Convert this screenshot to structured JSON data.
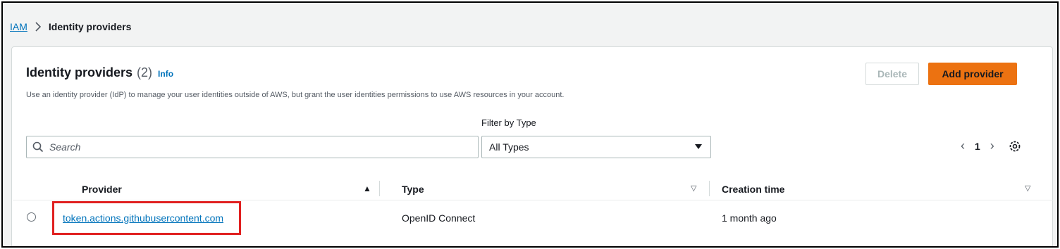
{
  "breadcrumb": {
    "root": "IAM",
    "current": "Identity providers"
  },
  "panel": {
    "title": "Identity providers",
    "count": "(2)",
    "info_label": "Info",
    "description": "Use an identity provider (IdP) to manage your user identities outside of AWS, but grant the user identities permissions to use AWS resources in your account."
  },
  "actions": {
    "delete_label": "Delete",
    "add_label": "Add provider"
  },
  "search": {
    "placeholder": "Search",
    "value": ""
  },
  "filter": {
    "label": "Filter by Type",
    "selected": "All Types"
  },
  "pagination": {
    "current_page": "1"
  },
  "table": {
    "columns": [
      "Provider",
      "Type",
      "Creation time"
    ],
    "rows": [
      {
        "provider": "token.actions.githubusercontent.com",
        "type": "OpenID Connect",
        "creation_time": "1 month ago"
      }
    ]
  },
  "colors": {
    "primary_button": "#ec7211",
    "link": "#0073bb",
    "highlight_box": "#e02020"
  }
}
